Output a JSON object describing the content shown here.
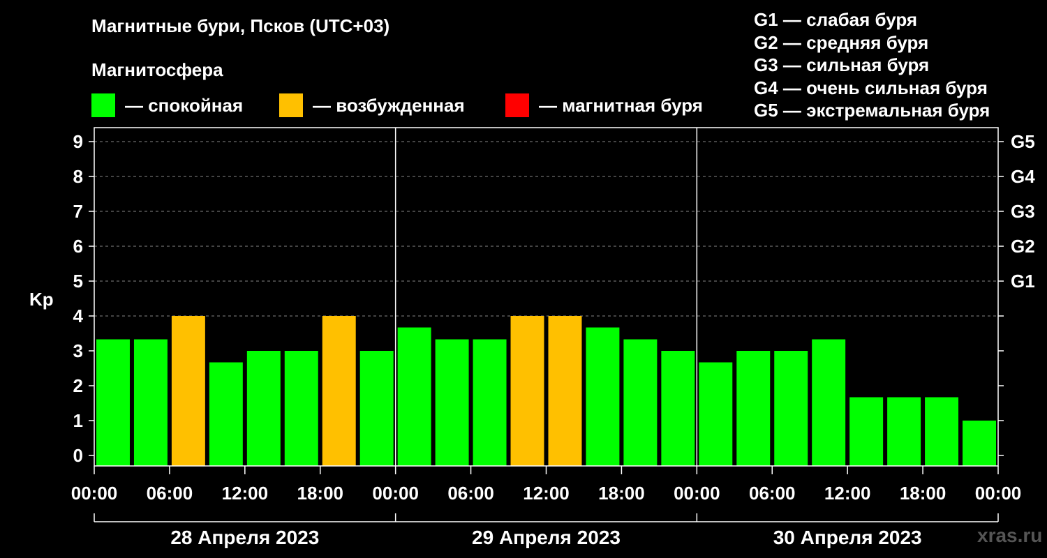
{
  "header": {
    "title": "Магнитные бури, Псков (UTC+03)",
    "subtitle": "Магнитосфера"
  },
  "legend": [
    {
      "label": "— спокойная",
      "color": "#00ff00"
    },
    {
      "label": "— возбужденная",
      "color": "#ffc000"
    },
    {
      "label": "— магнитная буря",
      "color": "#ff0000"
    }
  ],
  "storm_legend": [
    "G1 — слабая буря",
    "G2 — средняя буря",
    "G3 — сильная буря",
    "G4 — очень сильная буря",
    "G5 — экстремальная буря"
  ],
  "watermark": "xras.ru",
  "chart_data": {
    "type": "bar",
    "ylabel": "Kp",
    "ylim": [
      0,
      9
    ],
    "yticks": [
      "0",
      "1",
      "2",
      "3",
      "4",
      "5",
      "6",
      "7",
      "8",
      "9"
    ],
    "right_ticks": [
      {
        "value": 5,
        "label": "G1"
      },
      {
        "value": 6,
        "label": "G2"
      },
      {
        "value": 7,
        "label": "G3"
      },
      {
        "value": 8,
        "label": "G4"
      },
      {
        "value": 9,
        "label": "G5"
      }
    ],
    "xticks": [
      "00:00",
      "06:00",
      "12:00",
      "18:00",
      "00:00",
      "06:00",
      "12:00",
      "18:00",
      "00:00",
      "06:00",
      "12:00",
      "18:00",
      "00:00"
    ],
    "days": [
      "28 Апреля 2023",
      "29 Апреля 2023",
      "30 Апреля 2023"
    ],
    "grid": true,
    "values": [
      3.33,
      3.33,
      4,
      2.67,
      3,
      3,
      4,
      3,
      3.67,
      3.33,
      3.33,
      4,
      4,
      3.67,
      3.33,
      3,
      2.67,
      3,
      3,
      3.33,
      1.67,
      1.67,
      1.67,
      1
    ],
    "status": [
      "quiet",
      "quiet",
      "excited",
      "quiet",
      "quiet",
      "quiet",
      "excited",
      "quiet",
      "quiet",
      "quiet",
      "quiet",
      "excited",
      "excited",
      "quiet",
      "quiet",
      "quiet",
      "quiet",
      "quiet",
      "quiet",
      "quiet",
      "quiet",
      "quiet",
      "quiet",
      "quiet"
    ],
    "colors": {
      "quiet": "#00ff00",
      "excited": "#ffc000",
      "storm": "#ff0000"
    }
  }
}
